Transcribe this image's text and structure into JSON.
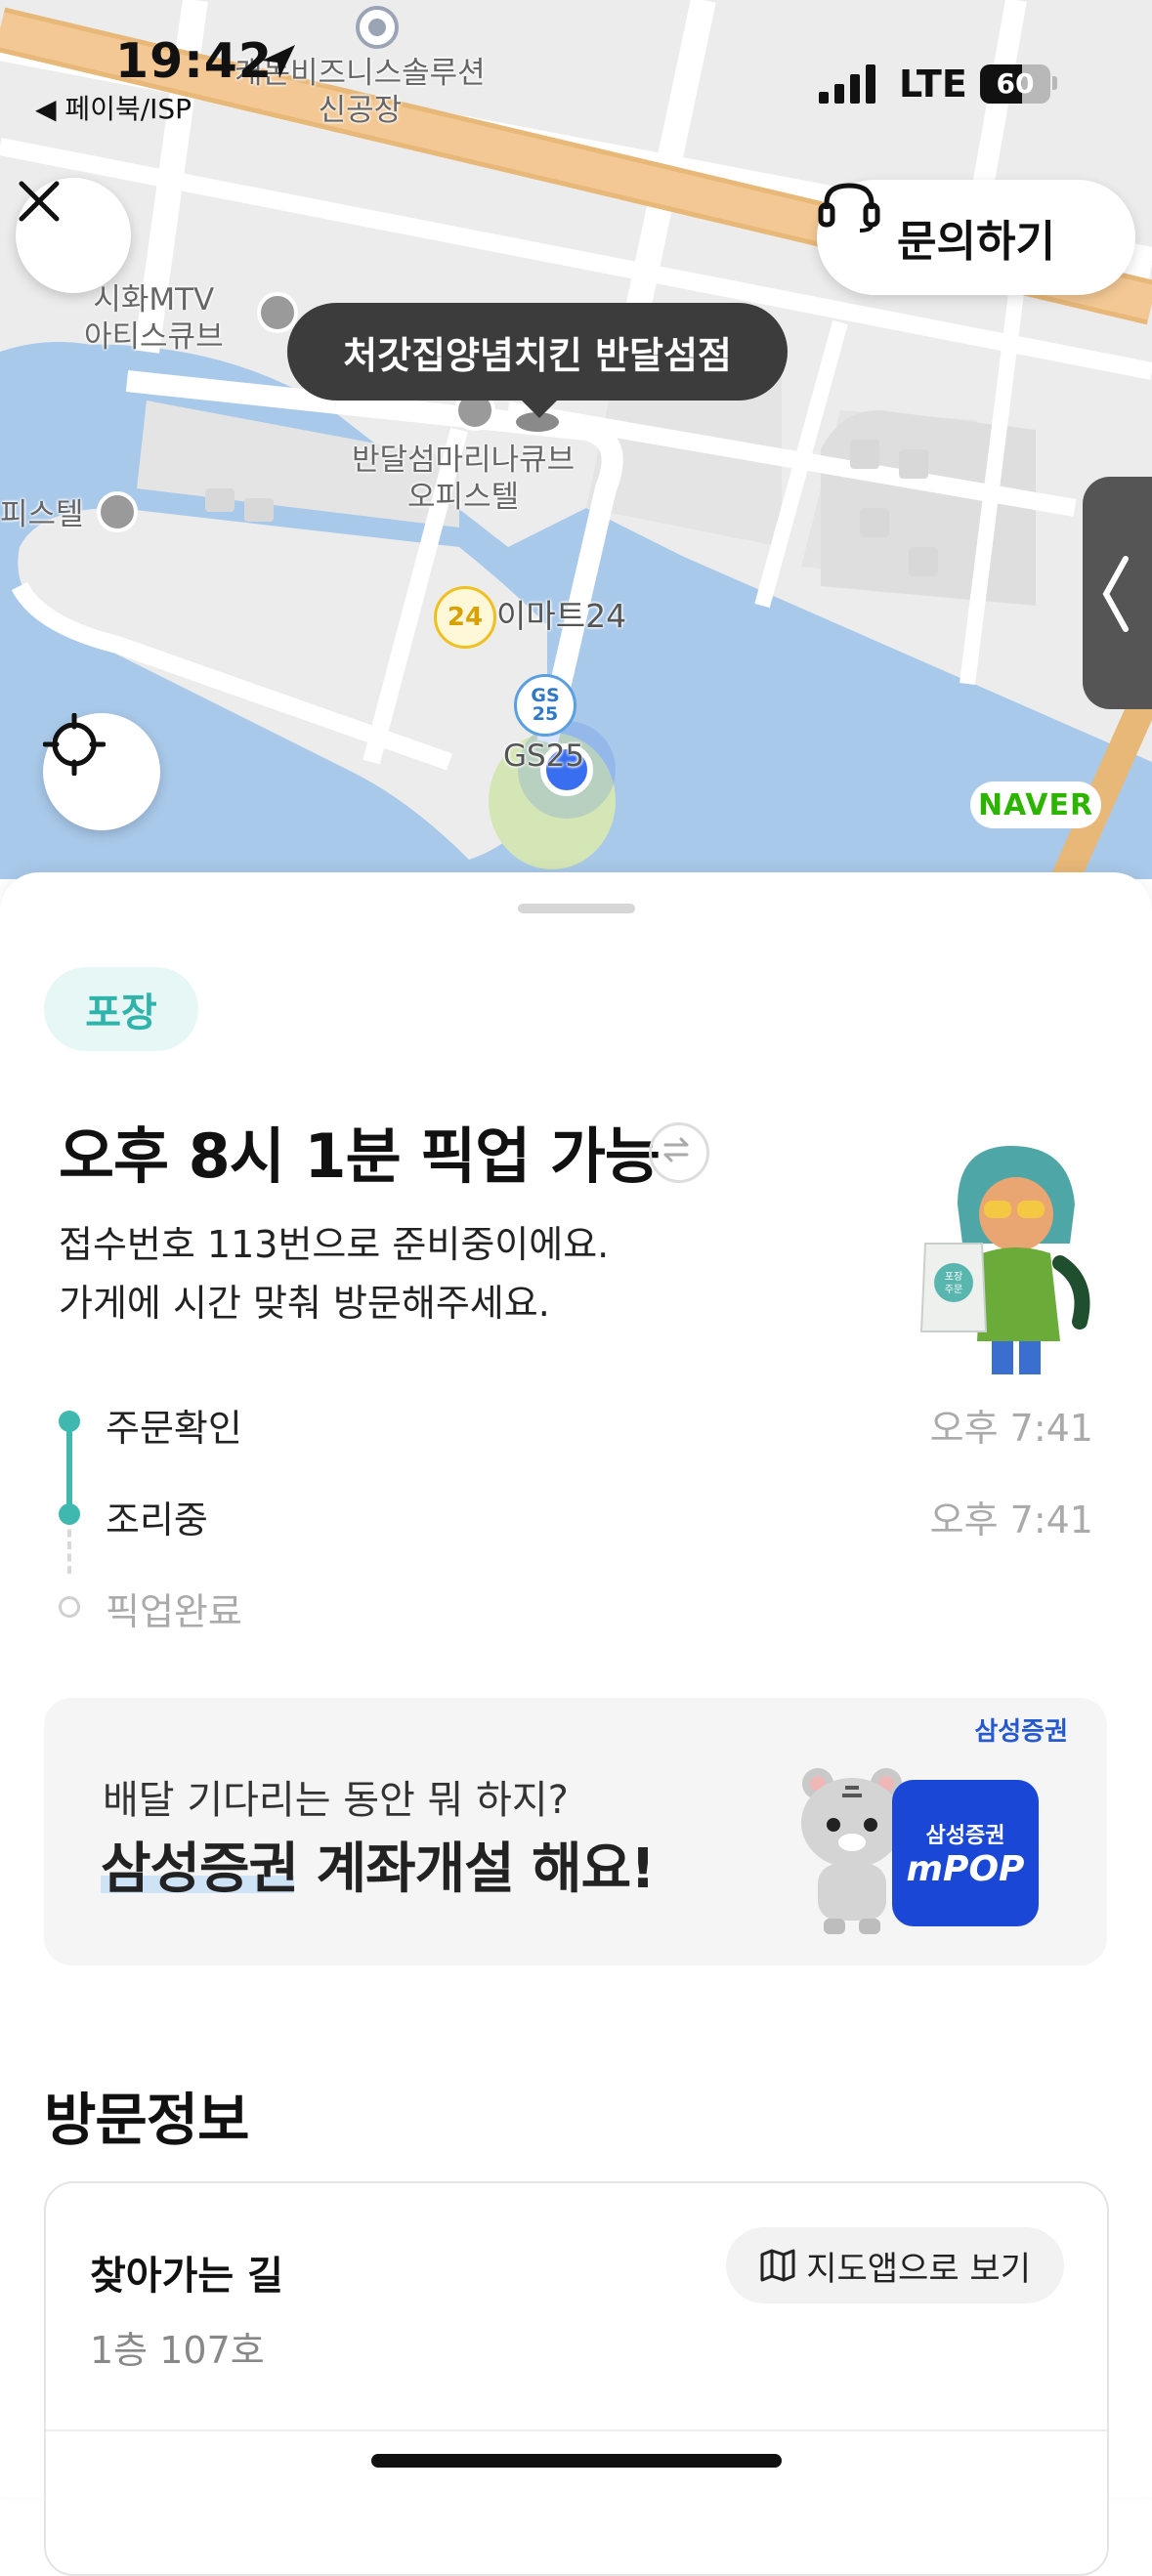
{
  "status_bar": {
    "time": "19:42",
    "back_app": "◀ 페이북/ISP",
    "network": "LTE",
    "battery": "60",
    "battery_level_percent": 60
  },
  "map": {
    "labels": {
      "biz": "캐논비즈니스솔루션\n신공장",
      "mtv": "시화MTV\n아티스큐브",
      "marina": "반달섬마리나큐브\n오피스텔",
      "officetel": "피스텔",
      "emart": "이마트24",
      "emart_logo": "24",
      "gs": "GS25",
      "gs_logo": "GS\n25",
      "naver": "NAVER"
    },
    "store_tooltip": "처갓집양념치킨 반달섬점",
    "inquiry_button": "문의하기"
  },
  "order": {
    "badge": "포장",
    "headline": "오후 8시 1분 픽업 가능",
    "description_line1": "접수번호 113번으로 준비중이에요.",
    "description_line2": "가게에 시간 맞춰 방문해주세요.",
    "character_bag_text": "포장\n주문",
    "steps": [
      {
        "label": "주문확인",
        "time": "오후 7:41",
        "done": true
      },
      {
        "label": "조리중",
        "time": "오후 7:41",
        "done": true
      },
      {
        "label": "픽업완료",
        "time": "",
        "done": false
      }
    ]
  },
  "ad": {
    "brand": "삼성증권",
    "line1": "배달 기다리는 동안 뭐 하지?",
    "line2_highlight": "삼성증권",
    "line2_rest": " 계좌개설 해요!",
    "app_name_top": "삼성증권",
    "app_name_bottom": "mPOP"
  },
  "visit_info": {
    "title": "방문정보",
    "directions_title": "찾아가는 길",
    "directions_detail": "1층 107호",
    "map_app_button": "지도앱으로 보기"
  },
  "colors": {
    "accent_teal": "#3fb9af",
    "badge_bg": "#e6f7f6",
    "samsung_blue": "#1a47d6",
    "naver_green": "#2db400",
    "location_blue": "#3a6ef0"
  }
}
